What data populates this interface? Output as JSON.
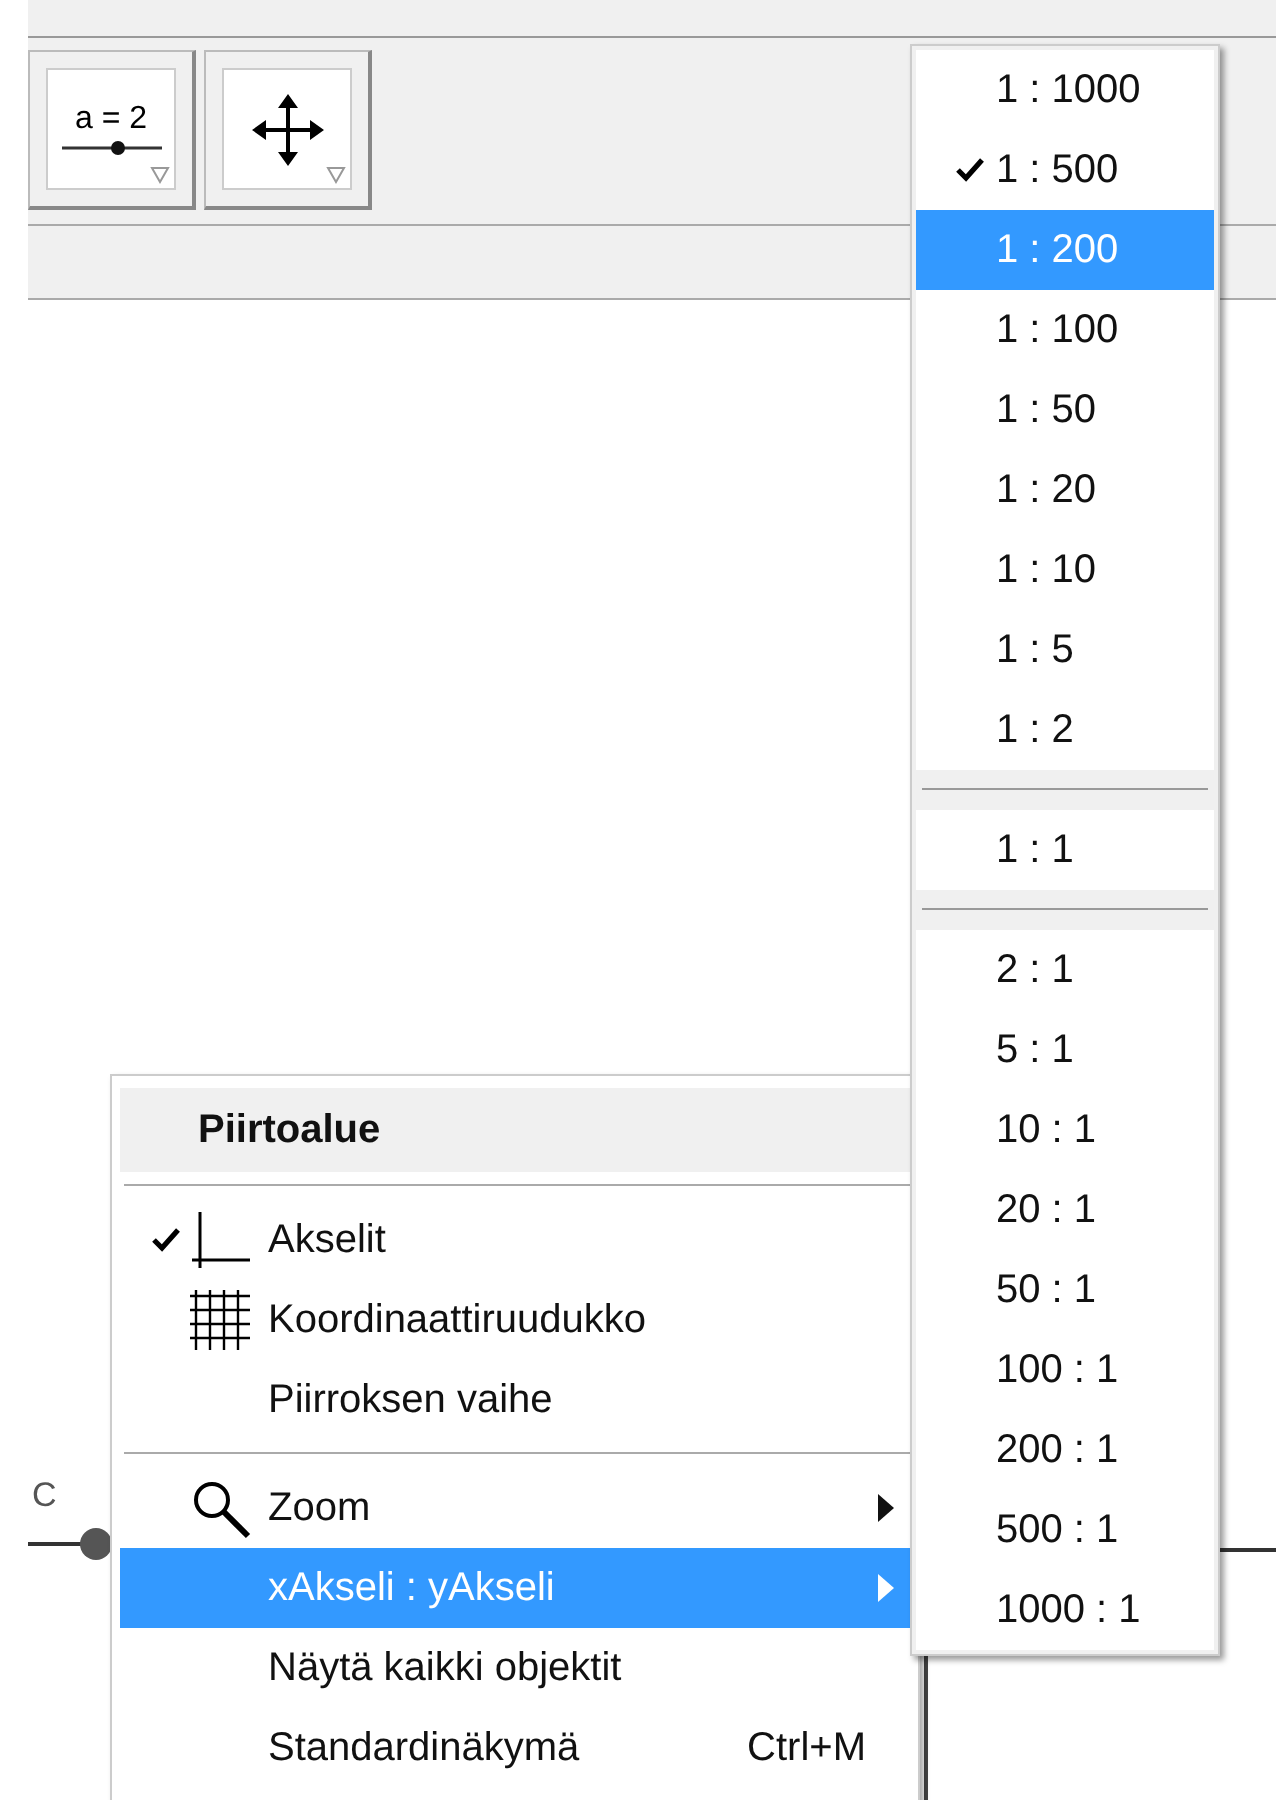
{
  "toolbar": {
    "tools": [
      {
        "kind": "slider",
        "label": "a = 2"
      },
      {
        "kind": "move"
      }
    ]
  },
  "canvas": {
    "point": {
      "label": "C"
    }
  },
  "context_menu": {
    "title": "Piirtoalue",
    "sections": [
      [
        {
          "label": "Akselit",
          "kind": "axes",
          "checked": true,
          "selected": false,
          "has_submenu": false
        },
        {
          "label": "Koordinaattiruudukko",
          "kind": "grid",
          "checked": false,
          "selected": false,
          "has_submenu": false
        },
        {
          "label": "Piirroksen vaihe",
          "kind": "plain",
          "checked": false,
          "selected": false,
          "has_submenu": false
        }
      ],
      [
        {
          "label": "Zoom",
          "kind": "zoom",
          "checked": false,
          "selected": false,
          "has_submenu": true
        },
        {
          "label": "xAkseli : yAkseli",
          "kind": "plain",
          "checked": false,
          "selected": true,
          "has_submenu": true
        },
        {
          "label": "Näytä kaikki objektit",
          "kind": "plain",
          "checked": false,
          "selected": false,
          "has_submenu": false
        },
        {
          "label": "Standardinäkymä",
          "kind": "plain",
          "checked": false,
          "selected": false,
          "has_submenu": false,
          "shortcut": "Ctrl+M"
        }
      ]
    ]
  },
  "scale_menu": {
    "sections": [
      [
        {
          "label": "1 : 1000",
          "checked": false,
          "selected": false
        },
        {
          "label": "1 : 500",
          "checked": true,
          "selected": false
        },
        {
          "label": "1 : 200",
          "checked": false,
          "selected": true
        },
        {
          "label": "1 : 100",
          "checked": false,
          "selected": false
        },
        {
          "label": "1 : 50",
          "checked": false,
          "selected": false
        },
        {
          "label": "1 : 20",
          "checked": false,
          "selected": false
        },
        {
          "label": "1 : 10",
          "checked": false,
          "selected": false
        },
        {
          "label": "1 : 5",
          "checked": false,
          "selected": false
        },
        {
          "label": "1 : 2",
          "checked": false,
          "selected": false
        }
      ],
      [
        {
          "label": "1 : 1",
          "checked": false,
          "selected": false
        }
      ],
      [
        {
          "label": "2 : 1",
          "checked": false,
          "selected": false
        },
        {
          "label": "5 : 1",
          "checked": false,
          "selected": false
        },
        {
          "label": "10 : 1",
          "checked": false,
          "selected": false
        },
        {
          "label": "20 : 1",
          "checked": false,
          "selected": false
        },
        {
          "label": "50 : 1",
          "checked": false,
          "selected": false
        },
        {
          "label": "100 : 1",
          "checked": false,
          "selected": false
        },
        {
          "label": "200 : 1",
          "checked": false,
          "selected": false
        },
        {
          "label": "500 : 1",
          "checked": false,
          "selected": false
        },
        {
          "label": "1000 : 1",
          "checked": false,
          "selected": false
        }
      ]
    ]
  }
}
